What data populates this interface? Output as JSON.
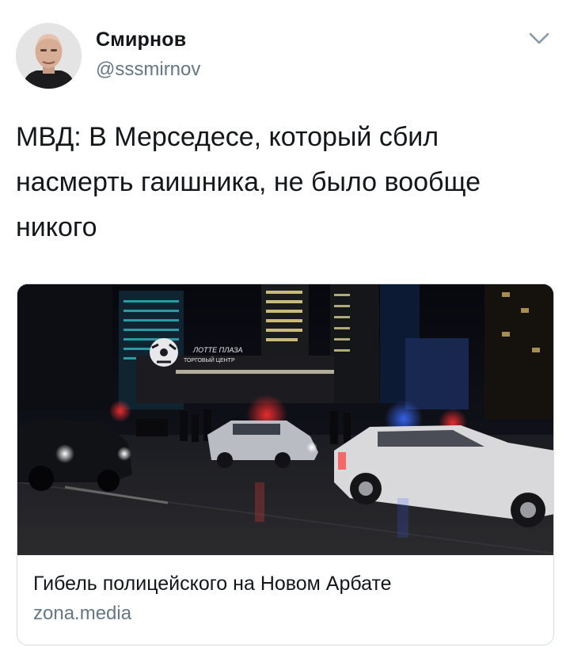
{
  "author": {
    "display_name": "Смирнов",
    "handle": "@sssmirnov"
  },
  "tweet": {
    "text": "МВД: В Мерседесе, который сбил насмерть гаишника, не было вообще никого"
  },
  "card": {
    "title": "Гибель полицейского на Новом Арбате",
    "domain": "zona.media",
    "sign_line_1": "ЛОТТЕ ПЛАЗА",
    "sign_line_2": "ТОРГОВЫЙ ЦЕНТР"
  },
  "icons": {
    "caret": "chevron-down-icon"
  },
  "colors": {
    "text_primary": "#14171a",
    "text_secondary": "#657786",
    "border": "#d5dde3",
    "caret": "#8899a6"
  }
}
